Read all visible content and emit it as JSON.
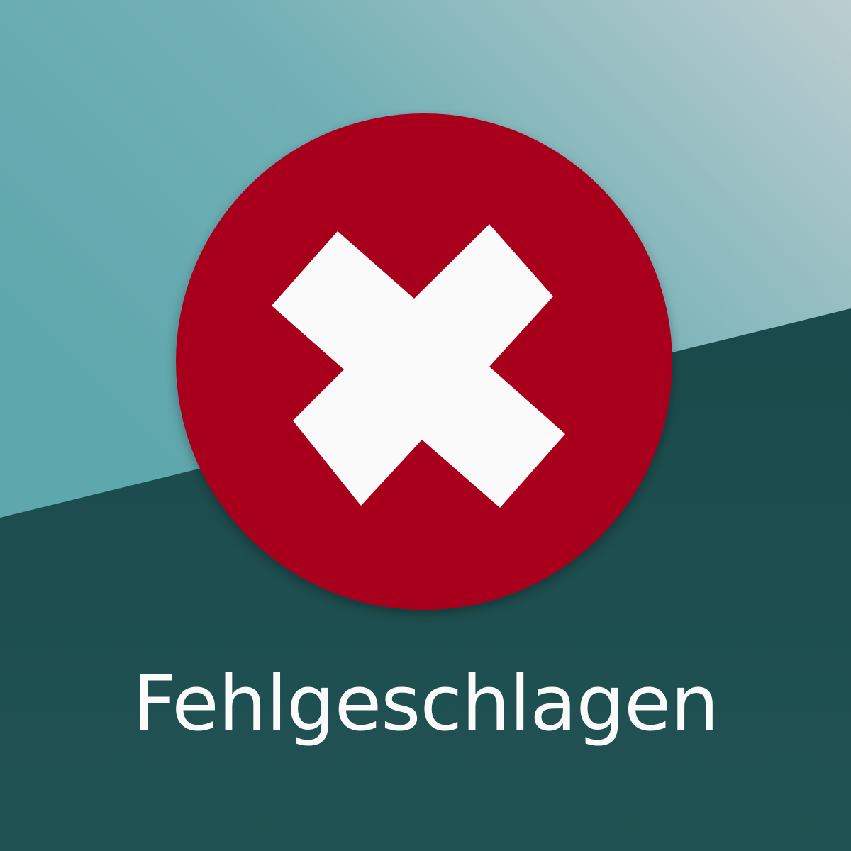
{
  "status": {
    "text": "Fehlgeschlagen",
    "icon": "close-x-icon",
    "colors": {
      "circle": "#a8001c",
      "cross": "#fafafa",
      "background_top_left": "#5ea7ad",
      "background_top_right": "#b6cacd",
      "background_bottom": "#1c4b4d"
    }
  }
}
